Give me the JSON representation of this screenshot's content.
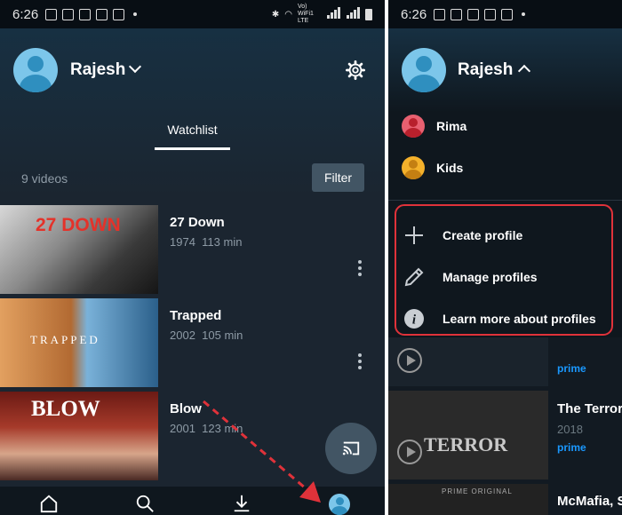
{
  "status_bar": {
    "time": "6:26",
    "network_label": "Vo) WiFi1 LTE"
  },
  "left": {
    "profile": {
      "name": "Rajesh"
    },
    "tabs": [
      {
        "label": "Watchlist"
      }
    ],
    "video_count": "9 videos",
    "filter_label": "Filter",
    "videos": [
      {
        "title": "27 Down",
        "year": "1974",
        "duration": "113 min",
        "poster_text": "27 DOWN"
      },
      {
        "title": "Trapped",
        "year": "2002",
        "duration": "105 min",
        "poster_text": "TRAPPED"
      },
      {
        "title": "Blow",
        "year": "2001",
        "duration": "123 min",
        "poster_text": "BLOW"
      }
    ]
  },
  "right": {
    "profile": {
      "name": "Rajesh"
    },
    "other_profiles": [
      {
        "name": "Rima"
      },
      {
        "name": "Kids"
      }
    ],
    "menu": [
      {
        "label": "Create profile",
        "icon": "plus-icon"
      },
      {
        "label": "Manage profiles",
        "icon": "pencil-icon"
      },
      {
        "label": "Learn more about profiles",
        "icon": "info-icon"
      }
    ],
    "background_items": [
      {
        "title": "",
        "sub": "",
        "badge": "prime"
      },
      {
        "title": "The Terror",
        "sub": "2018",
        "badge": "prime",
        "poster_text": "TERROR"
      },
      {
        "title": "McMafia, S",
        "sub": "",
        "badge": "",
        "poster_text": "PRIME ORIGINAL"
      }
    ]
  },
  "colors": {
    "accent": "#1a98ff",
    "highlight": "#e0323a",
    "button": "#425564"
  }
}
